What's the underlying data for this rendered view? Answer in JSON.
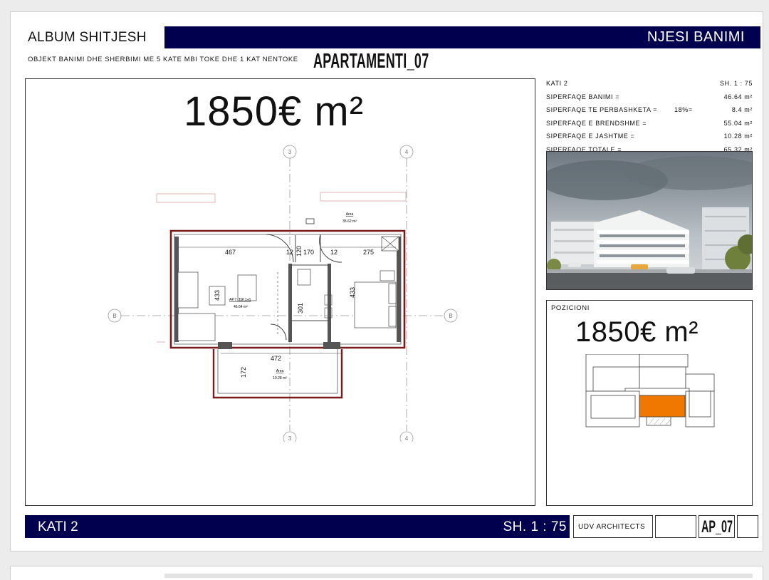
{
  "header": {
    "album_title": "ALBUM SHITJESH",
    "band_title": "NJESI BANIMI",
    "subtitle": "OBJEKT BANIMI DHE SHERBIMI ME 5 KATE MBI TOKE DHE 1 KAT NENTOKE",
    "apartment": "APARTAMENTI_07"
  },
  "plan": {
    "price": "1850€ m²",
    "grid_labels": {
      "col_3": "3",
      "col_4": "4",
      "row_b": "B"
    },
    "area_label": "Area",
    "common_area_value": "35.62 m²",
    "unit_label": "AP.7, TIP 1+1",
    "unit_area": "46.64 m²",
    "balcony_area": "10.28 m²",
    "dims": {
      "d467": "467",
      "d12a": "12",
      "d120": "120",
      "d170": "170",
      "d12b": "12",
      "d275": "275",
      "d433a": "433",
      "d433b": "433",
      "d301": "301",
      "d472": "472",
      "d172": "172"
    }
  },
  "info": {
    "floor": "KATI 2",
    "scale": "SH. 1 : 75",
    "rows": [
      {
        "label": "SIPERFAQE BANIMI =",
        "pct": "",
        "value": "46.64 m²"
      },
      {
        "label": "SIPERFAQE TE PERBASHKETA =",
        "pct": "18%=",
        "value": "8.4 m²"
      },
      {
        "label": "SIPERFAQE E BRENDSHME =",
        "pct": "",
        "value": "55.04 m²"
      },
      {
        "label": "SIPERFAQE E JASHTME =",
        "pct": "",
        "value": "10.28 m²"
      },
      {
        "label": "SIPERFAQE TOTALE =",
        "pct": "",
        "value": "65.32 m²"
      }
    ]
  },
  "position": {
    "label": "POZICIONI",
    "price": "1850€ m²",
    "highlight_color": "#f07800"
  },
  "footer": {
    "floor": "KATI 2",
    "scale": "SH. 1 : 75",
    "architects": "UDV ARCHITECTS",
    "code": "AP_07"
  },
  "colors": {
    "navy": "#00004f",
    "wall_red": "#7a1a1a",
    "accent_orange": "#f07800"
  }
}
